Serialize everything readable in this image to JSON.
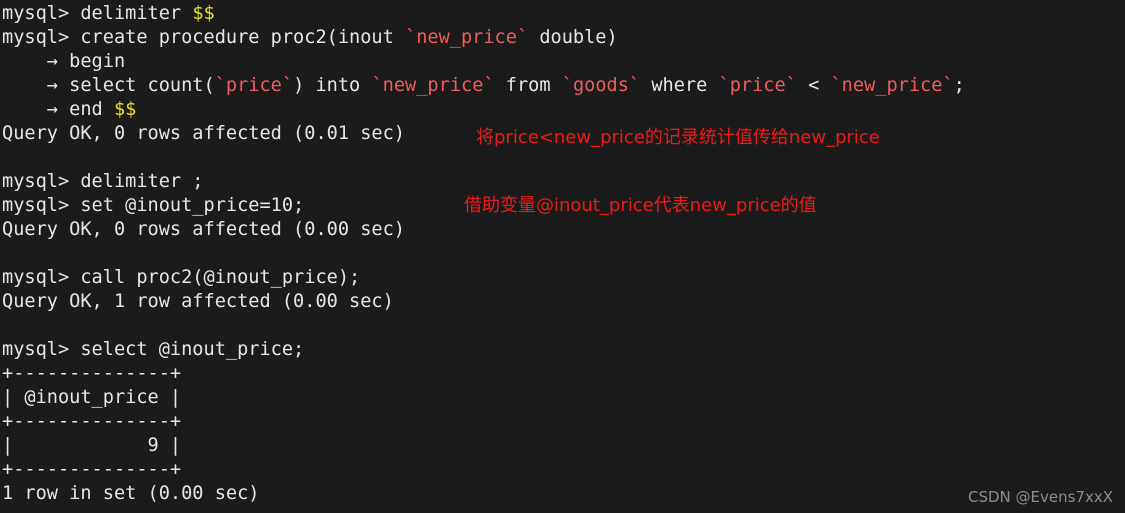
{
  "terminal": {
    "background_color": "#1b1b1b",
    "text_color": "#e6e6e6",
    "identifier_color": "#f05b5b",
    "delimiter_color": "#e8e02a",
    "annotation_color": "#ee1a1a",
    "watermark_color": "#8c8c8c",
    "prompt": "mysql>",
    "continuation_prompt": "->",
    "lines": [
      {
        "id": "line-1",
        "kind": "command",
        "text": "mysql> delimiter $$",
        "segments": [
          {
            "text": "mysql> delimiter ",
            "style": "plain"
          },
          {
            "text": "$$",
            "style": "delim"
          }
        ]
      },
      {
        "id": "line-2",
        "kind": "command",
        "text": "mysql> create procedure proc2(inout `new_price` double)",
        "segments": [
          {
            "text": "mysql> create procedure proc2(inout ",
            "style": "plain"
          },
          {
            "text": "`new_price`",
            "style": "ident"
          },
          {
            "text": " double)",
            "style": "plain"
          }
        ]
      },
      {
        "id": "line-3",
        "kind": "continuation",
        "text": "    → begin",
        "segments": [
          {
            "text": "    → begin",
            "style": "plain"
          }
        ]
      },
      {
        "id": "line-4",
        "kind": "continuation",
        "text": "    → select count(`price`) into `new_price` from `goods` where `price` < `new_price`;",
        "segments": [
          {
            "text": "    → select count(",
            "style": "plain"
          },
          {
            "text": "`price`",
            "style": "ident"
          },
          {
            "text": ") into ",
            "style": "plain"
          },
          {
            "text": "`new_price`",
            "style": "ident"
          },
          {
            "text": " from ",
            "style": "plain"
          },
          {
            "text": "`goods`",
            "style": "ident"
          },
          {
            "text": " where ",
            "style": "plain"
          },
          {
            "text": "`price`",
            "style": "ident"
          },
          {
            "text": " < ",
            "style": "plain"
          },
          {
            "text": "`new_price`",
            "style": "ident"
          },
          {
            "text": ";",
            "style": "plain"
          }
        ]
      },
      {
        "id": "line-5",
        "kind": "continuation",
        "text": "    → end $$",
        "segments": [
          {
            "text": "    → end ",
            "style": "plain"
          },
          {
            "text": "$$",
            "style": "delim"
          }
        ]
      },
      {
        "id": "line-6",
        "kind": "result",
        "text": "Query OK, 0 rows affected (0.01 sec)",
        "segments": [
          {
            "text": "Query OK, 0 rows affected (0.01 sec)",
            "style": "plain"
          }
        ]
      },
      {
        "id": "line-7",
        "kind": "blank",
        "text": "",
        "segments": []
      },
      {
        "id": "line-8",
        "kind": "command",
        "text": "mysql> delimiter ;",
        "segments": [
          {
            "text": "mysql> delimiter ;",
            "style": "plain"
          }
        ]
      },
      {
        "id": "line-9",
        "kind": "command",
        "text": "mysql> set @inout_price=10;",
        "segments": [
          {
            "text": "mysql> set @inout_price=10;",
            "style": "plain"
          }
        ]
      },
      {
        "id": "line-10",
        "kind": "result",
        "text": "Query OK, 0 rows affected (0.00 sec)",
        "segments": [
          {
            "text": "Query OK, 0 rows affected (0.00 sec)",
            "style": "plain"
          }
        ]
      },
      {
        "id": "line-11",
        "kind": "blank",
        "text": "",
        "segments": []
      },
      {
        "id": "line-12",
        "kind": "command",
        "text": "mysql> call proc2(@inout_price);",
        "segments": [
          {
            "text": "mysql> call proc2(@inout_price);",
            "style": "plain"
          }
        ]
      },
      {
        "id": "line-13",
        "kind": "result",
        "text": "Query OK, 1 row affected (0.00 sec)",
        "segments": [
          {
            "text": "Query OK, 1 row affected (0.00 sec)",
            "style": "plain"
          }
        ]
      },
      {
        "id": "line-14",
        "kind": "blank",
        "text": "",
        "segments": []
      },
      {
        "id": "line-15",
        "kind": "command",
        "text": "mysql> select @inout_price;",
        "segments": [
          {
            "text": "mysql> select @inout_price;",
            "style": "plain"
          }
        ]
      },
      {
        "id": "line-16",
        "kind": "table-border",
        "text": "+--------------+",
        "segments": [
          {
            "text": "+--------------+",
            "style": "plain"
          }
        ]
      },
      {
        "id": "line-17",
        "kind": "table-header",
        "text": "| @inout_price |",
        "segments": [
          {
            "text": "| @inout_price |",
            "style": "plain"
          }
        ]
      },
      {
        "id": "line-18",
        "kind": "table-border",
        "text": "+--------------+",
        "segments": [
          {
            "text": "+--------------+",
            "style": "plain"
          }
        ]
      },
      {
        "id": "line-19",
        "kind": "table-row",
        "text": "|            9 |",
        "segments": [
          {
            "text": "|            9 |",
            "style": "plain"
          }
        ]
      },
      {
        "id": "line-20",
        "kind": "table-border",
        "text": "+--------------+",
        "segments": [
          {
            "text": "+--------------+",
            "style": "plain"
          }
        ]
      },
      {
        "id": "line-21",
        "kind": "result",
        "text": "1 row in set (0.00 sec)",
        "segments": [
          {
            "text": "1 row in set (0.00 sec)",
            "style": "plain"
          }
        ]
      }
    ],
    "result_table": {
      "columns": [
        "@inout_price"
      ],
      "rows": [
        [
          "9"
        ]
      ],
      "row_count_text": "1 row in set (0.00 sec)"
    },
    "annotations": [
      {
        "id": "annotation-1",
        "text": "将price<new_price的记录统计值传给new_price"
      },
      {
        "id": "annotation-2",
        "text": "借助变量@inout_price代表new_price的值"
      }
    ],
    "watermark": "CSDN @Evens7xxX"
  }
}
